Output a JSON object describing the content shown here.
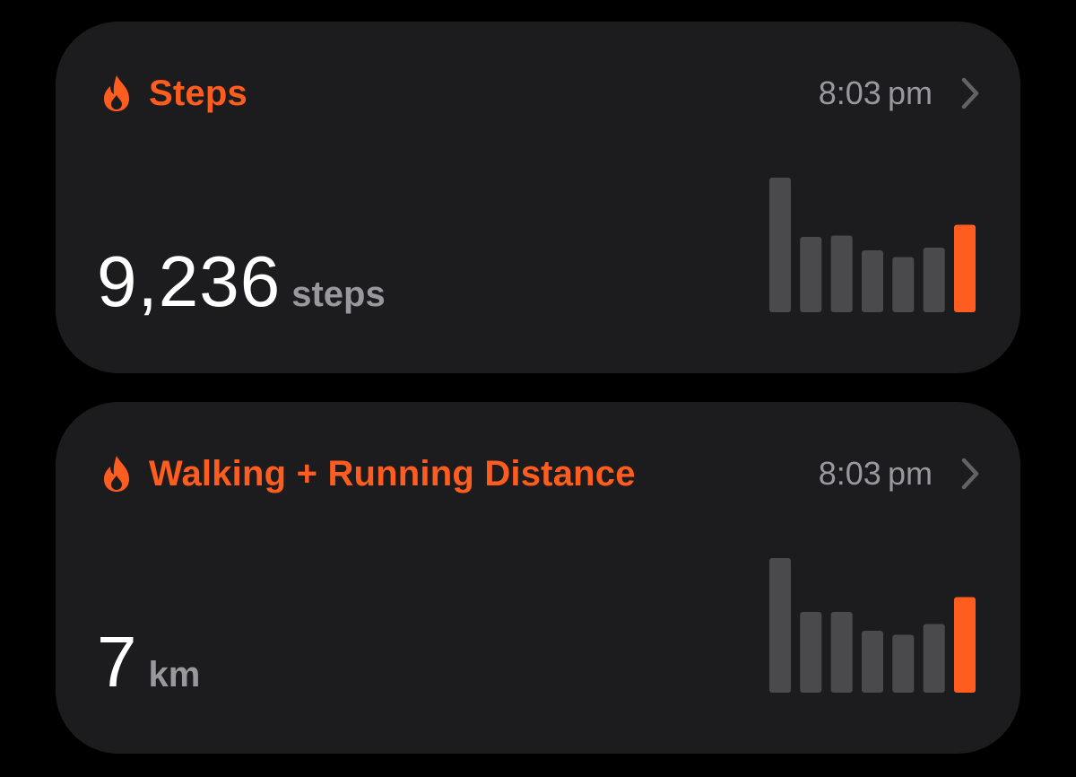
{
  "colors": {
    "accent": "#ff5c1f",
    "bar_inactive": "#4a4a4c",
    "card": "#1c1c1e",
    "secondary_text": "#98989d"
  },
  "cards": [
    {
      "title": "Steps",
      "time": "8:03 pm",
      "value": "9,236",
      "unit": "steps",
      "icon": "flame-icon",
      "chevron": "chevron-right-icon",
      "bars": [
        1.0,
        0.56,
        0.57,
        0.46,
        0.41,
        0.48,
        0.65
      ]
    },
    {
      "title": "Walking + Running Distance",
      "time": "8:03 pm",
      "value": "7",
      "unit": "km",
      "icon": "flame-icon",
      "chevron": "chevron-right-icon",
      "bars": [
        1.0,
        0.6,
        0.6,
        0.46,
        0.43,
        0.51,
        0.71
      ]
    }
  ]
}
